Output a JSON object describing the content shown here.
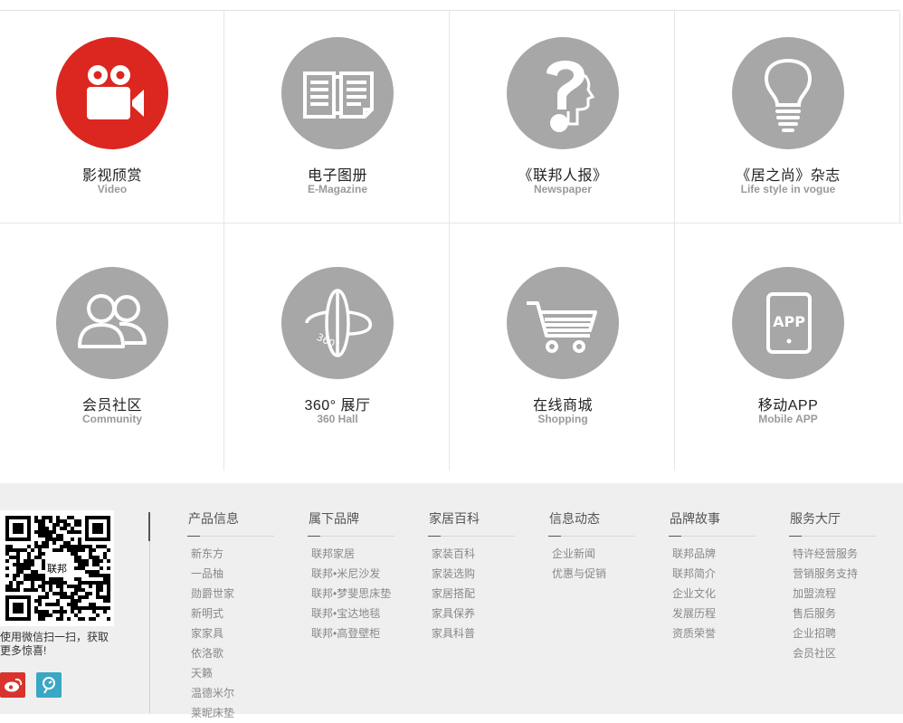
{
  "tiles": [
    {
      "title": "影视颀赏",
      "subtitle": "Video",
      "icon": "video-camera-icon",
      "color": "#dc2620"
    },
    {
      "title": "电子图册",
      "subtitle": "E-Magazine",
      "icon": "book-icon",
      "color": "#a7a7a7"
    },
    {
      "title": "《联邦人报》",
      "subtitle": "Newspaper",
      "icon": "question-head-icon",
      "color": "#a7a7a7"
    },
    {
      "title": "《居之尚》杂志",
      "subtitle": "Life style in vogue",
      "icon": "lightbulb-icon",
      "color": "#a7a7a7"
    },
    {
      "title": "会员社区",
      "subtitle": "Community",
      "icon": "users-icon",
      "color": "#a7a7a7"
    },
    {
      "title": "360° 展厅",
      "subtitle": "360 Hall",
      "icon": "rotate-360-icon",
      "icon_text": "360°",
      "color": "#a7a7a7"
    },
    {
      "title": "在线商城",
      "subtitle": "Shopping",
      "icon": "cart-icon",
      "color": "#a7a7a7"
    },
    {
      "title": "移动APP",
      "subtitle": "Mobile APP",
      "icon": "tablet-app-icon",
      "icon_text": "APP",
      "color": "#a7a7a7"
    }
  ],
  "footer": {
    "qr_logo": "联邦",
    "qr_caption": "使用微信扫一扫，获取更多惊喜!",
    "columns": [
      {
        "title": "产品信息",
        "items": [
          "新东方",
          "一品柚",
          "勋爵世家",
          "新明式",
          "家家具",
          "依洛歌",
          "天籁",
          "温德米尔",
          "莱昵床垫"
        ]
      },
      {
        "title": "属下品牌",
        "items": [
          "联邦家居",
          "联邦•米尼沙发",
          "联邦•梦斐思床垫",
          "联邦•宝达地毯",
          "联邦•高登壁柜"
        ]
      },
      {
        "title": "家居百科",
        "items": [
          "家装百科",
          "家装选购",
          "家居搭配",
          "家具保养",
          "家具科普"
        ]
      },
      {
        "title": "信息动态",
        "items": [
          "企业新闻",
          "优惠与促销"
        ]
      },
      {
        "title": "品牌故事",
        "items": [
          "联邦品牌",
          "联邦简介",
          "企业文化",
          "发展历程",
          "资质荣誉"
        ]
      },
      {
        "title": "服务大厅",
        "items": [
          "特许经营服务",
          "营销服务支持",
          "加盟流程",
          "售后服务",
          "企业招聘",
          "会员社区"
        ]
      }
    ],
    "social": [
      "weibo-icon",
      "wechat-icon"
    ]
  }
}
